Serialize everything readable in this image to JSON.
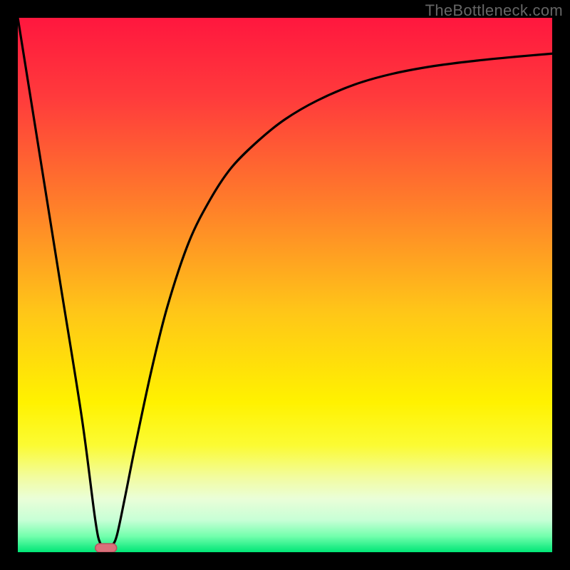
{
  "watermark": "TheBottleneck.com",
  "chart_data": {
    "type": "line",
    "title": "",
    "xlabel": "",
    "ylabel": "",
    "xlim": [
      0,
      100
    ],
    "ylim": [
      0,
      100
    ],
    "background_gradient": {
      "stops": [
        {
          "offset": 0.0,
          "color": "#ff173e"
        },
        {
          "offset": 0.15,
          "color": "#ff3b3c"
        },
        {
          "offset": 0.35,
          "color": "#ff7e2a"
        },
        {
          "offset": 0.55,
          "color": "#ffc618"
        },
        {
          "offset": 0.72,
          "color": "#fff200"
        },
        {
          "offset": 0.8,
          "color": "#fbfb33"
        },
        {
          "offset": 0.86,
          "color": "#f2fca0"
        },
        {
          "offset": 0.9,
          "color": "#eafed8"
        },
        {
          "offset": 0.94,
          "color": "#c7ffd6"
        },
        {
          "offset": 0.97,
          "color": "#73ffad"
        },
        {
          "offset": 1.0,
          "color": "#00e676"
        }
      ]
    },
    "series": [
      {
        "name": "bottleneck-curve",
        "type": "line",
        "x": [
          0,
          4,
          8,
          12,
          14.5,
          15.5,
          16.5,
          17.5,
          18.5,
          20,
          22,
          25,
          28,
          32,
          36,
          40,
          45,
          50,
          56,
          63,
          70,
          78,
          86,
          93,
          100
        ],
        "values": [
          100,
          75,
          50,
          25,
          6,
          1.5,
          1,
          1.2,
          3,
          10,
          20,
          34,
          46,
          58,
          66,
          72,
          77,
          81,
          84.5,
          87.5,
          89.5,
          91,
          92,
          92.7,
          93.3
        ]
      },
      {
        "name": "optimal-marker",
        "type": "marker",
        "shape": "capsule",
        "x": 16.5,
        "y": 0.8,
        "width_x": 4.0,
        "height_y": 1.6,
        "fill": "#d9707a",
        "stroke": "#b6525e"
      }
    ]
  }
}
